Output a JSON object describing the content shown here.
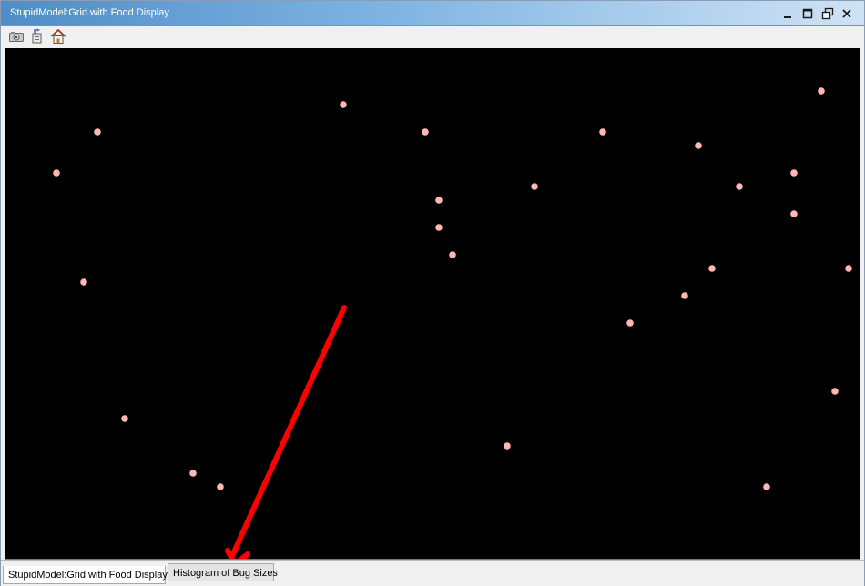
{
  "window": {
    "title": "StupidModel:Grid with Food Display"
  },
  "titlebar_controls": {
    "minimize": "minimize-icon",
    "maximize": "maximize-icon",
    "restore": "restore-icon",
    "close": "close-icon"
  },
  "toolbar": {
    "icons": [
      "camera-icon",
      "export-icon",
      "home-icon"
    ]
  },
  "display": {
    "background": "#000000",
    "agent_color": "#ffb6b6",
    "annotation_arrow_color": "#ff0000"
  },
  "tabs": [
    {
      "label": "StupidModel:Grid with Food Display",
      "selected": true
    },
    {
      "label": "Histogram of Bug Sizes",
      "selected": false
    }
  ]
}
